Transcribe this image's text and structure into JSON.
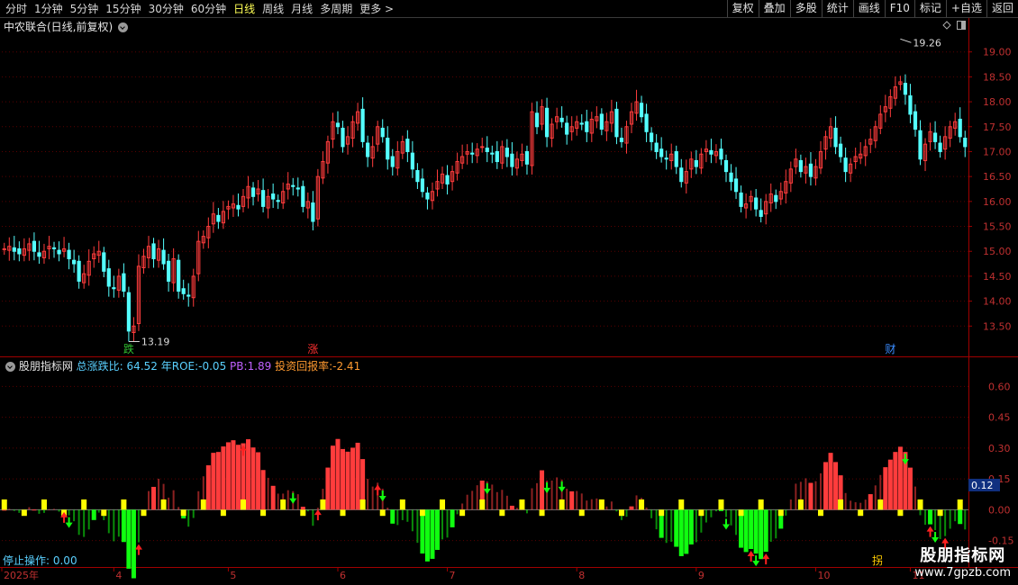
{
  "toolbar": {
    "periods": [
      "分时",
      "1分钟",
      "5分钟",
      "15分钟",
      "30分钟",
      "60分钟",
      "日线",
      "周线",
      "月线",
      "多周期",
      "更多 >"
    ],
    "active_period": "日线",
    "actions": [
      "复权",
      "叠加",
      "多股",
      "统计",
      "画线",
      "F10",
      "标记",
      "+自选",
      "返回"
    ]
  },
  "stock": {
    "title": "中农联合(日线,前复权)",
    "high_label": "19.26",
    "low_label": "13.19",
    "events": [
      {
        "text": "跌",
        "color": "#30c030",
        "idx": 25
      },
      {
        "text": "涨",
        "color": "#ff3030",
        "idx": 62
      },
      {
        "text": "财",
        "color": "#3a8cff",
        "idx": 178
      }
    ]
  },
  "indicator": {
    "name": "股朋指标网",
    "zdb_label": "总涨跌比:",
    "zdb_value": "64.52",
    "roe_label": "年ROE:",
    "roe_value": "-0.05",
    "pb_label": "PB:",
    "pb_value": "1.89",
    "tzhb_label": "投资回报率:",
    "tzhb_value": "-2.41",
    "current_value": "0.12",
    "stop_label": "停止操作: 0.00",
    "partial_label": "拐"
  },
  "price_axis": [
    "19.00",
    "18.50",
    "18.00",
    "17.50",
    "17.00",
    "16.50",
    "16.00",
    "15.50",
    "15.00",
    "14.50",
    "14.00",
    "13.50"
  ],
  "ind_axis": [
    "0.60",
    "0.45",
    "0.30",
    "0.15",
    "0.00",
    "-0.15"
  ],
  "time_axis": [
    {
      "label": "2025年",
      "idx": 0
    },
    {
      "label": "4",
      "idx": 22
    },
    {
      "label": "5",
      "idx": 45
    },
    {
      "label": "6",
      "idx": 67
    },
    {
      "label": "7",
      "idx": 89
    },
    {
      "label": "8",
      "idx": 115
    },
    {
      "label": "9",
      "idx": 139
    },
    {
      "label": "10",
      "idx": 163
    },
    {
      "label": "11",
      "idx": 182
    }
  ],
  "watermark": {
    "line1": "股朋指标网",
    "line2": "www.7gpzb.com"
  },
  "colors": {
    "up": "#ff3c3c",
    "down": "#54ffff",
    "green": "#10ff10",
    "yellow": "#ffff00",
    "axis": "#a00000"
  },
  "closes": [
    15.05,
    15.1,
    15.0,
    14.95,
    15.05,
    15.15,
    15.0,
    14.9,
    15.0,
    15.1,
    15.05,
    14.95,
    15.05,
    14.85,
    14.75,
    14.4,
    14.55,
    14.8,
    14.95,
    15.0,
    14.6,
    14.3,
    14.25,
    14.5,
    14.2,
    13.4,
    13.5,
    14.7,
    14.9,
    15.1,
    14.85,
    15.05,
    14.75,
    14.4,
    14.85,
    14.2,
    14.15,
    14.1,
    14.5,
    15.2,
    15.3,
    15.5,
    15.75,
    15.6,
    15.8,
    15.9,
    15.95,
    15.85,
    16.1,
    16.3,
    16.1,
    16.25,
    15.9,
    16.1,
    16.05,
    16.0,
    16.2,
    16.35,
    16.3,
    16.25,
    15.9,
    16.0,
    15.6,
    16.5,
    16.8,
    17.2,
    17.6,
    17.5,
    17.1,
    17.3,
    17.6,
    17.8,
    17.2,
    16.9,
    17.1,
    17.5,
    17.3,
    16.85,
    16.7,
    17.0,
    17.2,
    17.0,
    16.65,
    16.4,
    16.2,
    16.05,
    16.2,
    16.4,
    16.55,
    16.35,
    16.6,
    16.8,
    16.9,
    17.0,
    16.95,
    17.05,
    17.1,
    17.0,
    16.95,
    16.8,
    17.1,
    16.9,
    16.7,
    16.85,
    16.95,
    16.75,
    17.8,
    17.5,
    17.9,
    17.3,
    17.55,
    17.7,
    17.6,
    17.35,
    17.5,
    17.6,
    17.55,
    17.4,
    17.65,
    17.7,
    17.45,
    17.6,
    17.8,
    17.3,
    17.2,
    17.5,
    17.8,
    18.0,
    17.7,
    17.4,
    17.2,
    17.0,
    16.9,
    16.85,
    16.95,
    16.7,
    16.4,
    16.6,
    16.85,
    16.7,
    16.95,
    17.05,
    16.95,
    17.0,
    16.85,
    16.6,
    16.4,
    16.2,
    15.9,
    15.95,
    16.1,
    15.85,
    15.7,
    16.0,
    16.15,
    16.0,
    16.2,
    16.4,
    16.65,
    16.85,
    16.6,
    16.7,
    16.5,
    16.7,
    17.0,
    17.3,
    17.5,
    17.1,
    16.9,
    16.6,
    16.75,
    16.9,
    16.95,
    17.1,
    17.25,
    17.5,
    17.75,
    17.9,
    18.1,
    18.3,
    18.4,
    18.15,
    17.75,
    17.45,
    16.85,
    17.15,
    17.4,
    17.2,
    17.0,
    17.3,
    17.5,
    17.6,
    17.3,
    17.1
  ]
}
